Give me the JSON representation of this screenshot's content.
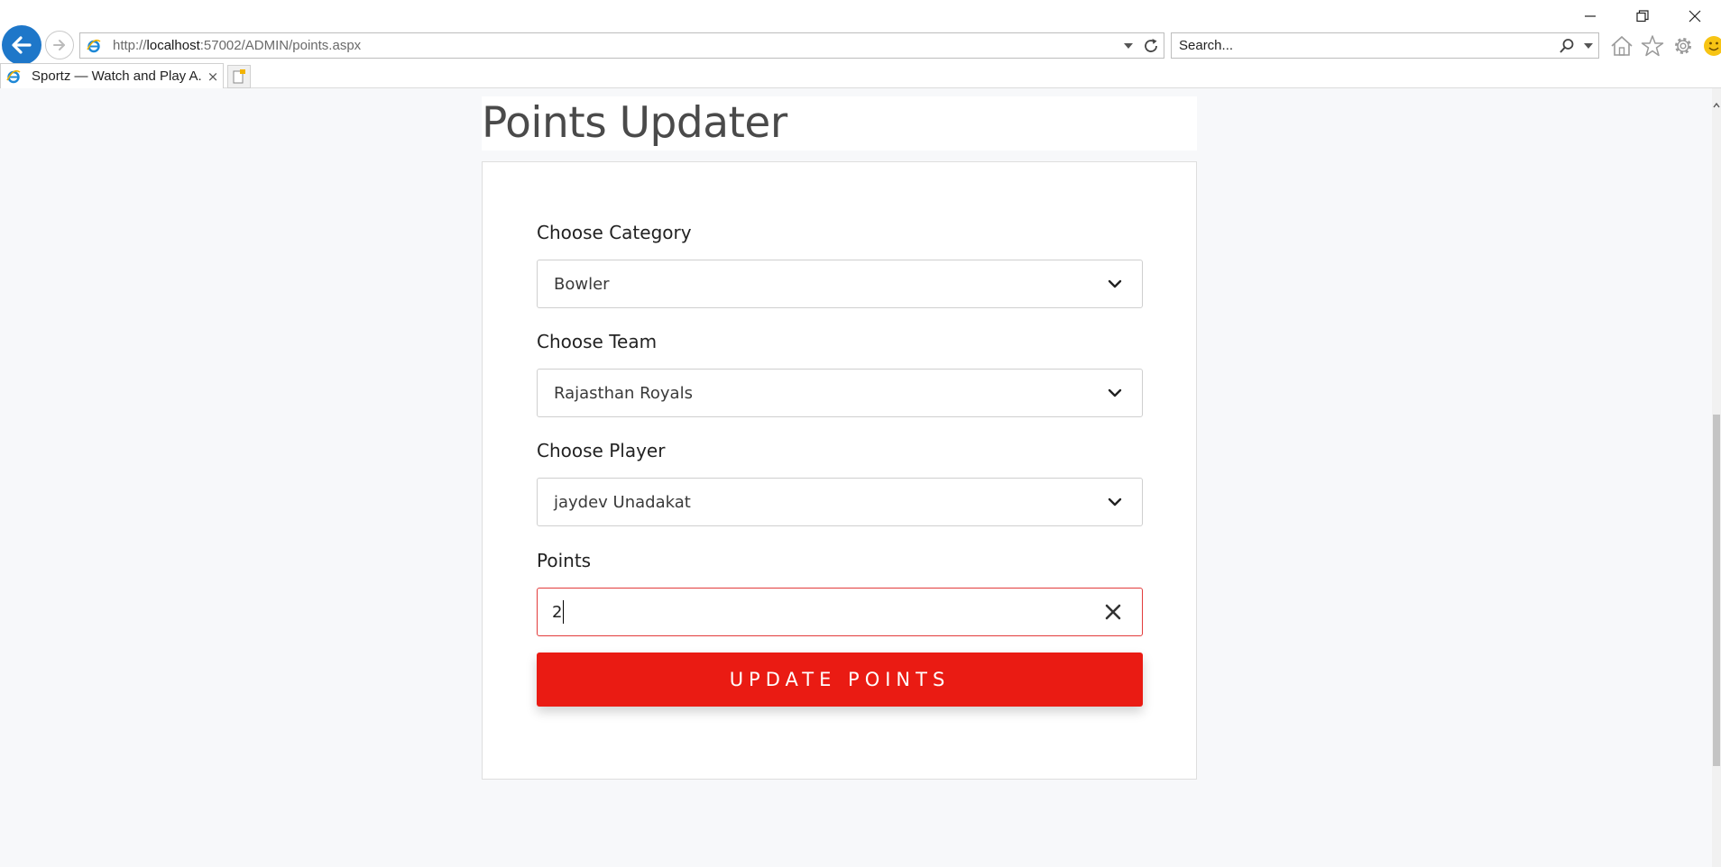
{
  "browser": {
    "url_prefix": "http://",
    "url_host": "localhost",
    "url_rest": ":57002/ADMIN/points.aspx",
    "search_placeholder": "Search...",
    "tab_title": "Sportz — Watch and Play A...",
    "tab_close": "×",
    "icons": [
      "back-arrow-icon",
      "forward-arrow-icon",
      "ie-logo-icon",
      "refresh-icon",
      "search-icon",
      "home-icon",
      "favorites-star-icon",
      "gear-icon",
      "smiley-icon"
    ]
  },
  "page": {
    "title": "Points Updater"
  },
  "form": {
    "category": {
      "label": "Choose Category",
      "value": "Bowler"
    },
    "team": {
      "label": "Choose Team",
      "value": "Rajasthan Royals"
    },
    "player": {
      "label": "Choose Player",
      "value": "jaydev Unadakat"
    },
    "points": {
      "label": "Points",
      "value": "2"
    },
    "submit_label": "UPDATE POINTS"
  },
  "colors": {
    "accent": "#ea1b13",
    "invalid_border": "#e23b3b",
    "page_bg": "#f7f8fa",
    "browser_back": "#1e77c9"
  }
}
